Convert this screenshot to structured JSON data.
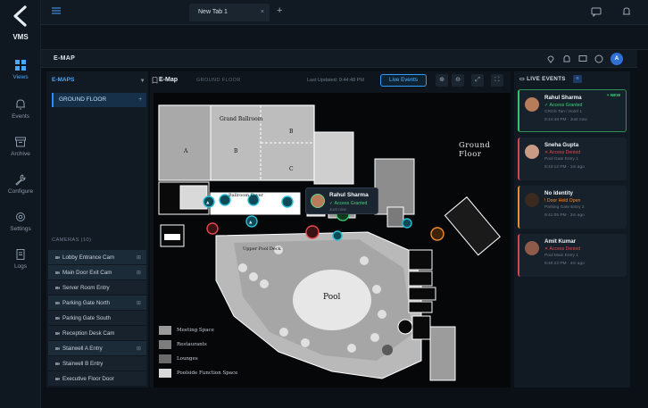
{
  "app": {
    "logo_text": "VMS"
  },
  "nav": [
    {
      "label": "Views",
      "icon": "grid-icon"
    },
    {
      "label": "Events",
      "icon": "bell-icon"
    },
    {
      "label": "Archive",
      "icon": "archive-icon"
    },
    {
      "label": "Configure",
      "icon": "wrench-icon"
    },
    {
      "label": "Settings",
      "icon": "gear-icon"
    },
    {
      "label": "Logs",
      "icon": "document-icon"
    }
  ],
  "topbar": {
    "tab_label": "New Tab 1",
    "tab_close": "×",
    "new_tab": "+"
  },
  "page": {
    "title": "E-MAP",
    "avatar": "A"
  },
  "left_panel": {
    "header": "E-MAPS",
    "floor": "GROUND FLOOR",
    "cameras_header": "CAMERAS (10)",
    "cameras": [
      {
        "label": "Lobby Entrance Cam",
        "highlight": true
      },
      {
        "label": "Main Door Exit Cam",
        "highlight": true
      },
      {
        "label": "Server Room Entry",
        "highlight": false
      },
      {
        "label": "Parking Gate North",
        "highlight": true
      },
      {
        "label": "Parking Gate South",
        "highlight": false
      },
      {
        "label": "Reception Desk Cam",
        "highlight": false
      },
      {
        "label": "Stairwell A Entry",
        "highlight": true
      },
      {
        "label": "Stairwell B Entry",
        "highlight": false
      },
      {
        "label": "Executive Floor Door",
        "highlight": false
      }
    ]
  },
  "center_panel": {
    "title": "E-Map",
    "subtitle": "GROUND FLOOR",
    "updated": "Last Updated: 9:44:48 PM",
    "live_button": "Live Events"
  },
  "map": {
    "floor_label": "Ground Floor",
    "rooms": {
      "grand_ballroom": "Grand Ballroom",
      "a": "A",
      "b": "B",
      "c": "C",
      "d": "D",
      "pool": "Pool",
      "upper_pool_deck": "Upper Pool Deck",
      "ballroom_foyer": "Ballroom Foyer"
    },
    "legend": [
      {
        "label": "Meeting Space",
        "color": "#9a9a9a"
      },
      {
        "label": "Restaurants",
        "color": "#7d7d7d"
      },
      {
        "label": "Lounges",
        "color": "#6a6a6a"
      },
      {
        "label": "Poolside Function Space",
        "color": "#d9d9d9"
      }
    ]
  },
  "popup": {
    "name": "Rahul Sharma",
    "status": "✓ Access Granted",
    "time": "Just now"
  },
  "right_panel": {
    "header": "LIVE EVENTS",
    "events": [
      {
        "name": "Rahul Sharma",
        "status": "✓ Access Granted",
        "status_color": "#3ed27a",
        "location": "CROS Tan / Hotel 1",
        "time": "9:44:48 PM · Just now",
        "new_label": "+ NEW",
        "kind": "granted",
        "avatar_color": "#b77c59"
      },
      {
        "name": "Sneha Gupta",
        "status": "✕ Access Denied",
        "status_color": "#e5484d",
        "location": "Pool Gate Entry 1",
        "time": "9:43:12 PM · 1m ago",
        "new_label": "",
        "kind": "denied",
        "avatar_color": "#c99a84"
      },
      {
        "name": "No Identity",
        "status": "! Door Held Open",
        "status_color": "#f08a2e",
        "location": "Parking Gate Entry 2",
        "time": "9:41:05 PM · 3m ago",
        "new_label": "",
        "kind": "hold",
        "avatar_color": "#3a2a20"
      },
      {
        "name": "Amit Kumar",
        "status": "✕ Access Denied",
        "status_color": "#e5484d",
        "location": "Pool Main Entry 1",
        "time": "9:40:22 PM · 4m ago",
        "new_label": "",
        "kind": "denied",
        "avatar_color": "#8e5a4a"
      }
    ]
  }
}
